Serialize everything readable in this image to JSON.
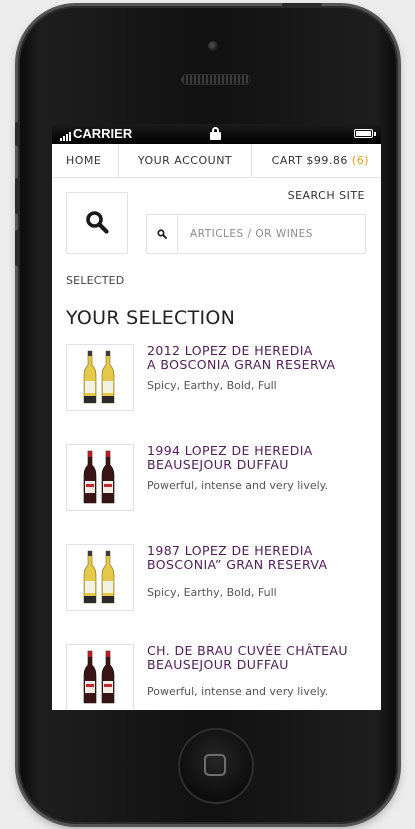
{
  "status_bar": {
    "carrier": "CARRIER"
  },
  "nav": {
    "home": "HOME",
    "account": "YOUR ACCOUNT",
    "cart_label": "CART $99.86",
    "cart_count": "(6)"
  },
  "search": {
    "title": "SEARCH SITE",
    "placeholder": "ARTICLES / OR WINES"
  },
  "selected_label": "SELECTED",
  "section_title": "YOUR SELECTION",
  "products": [
    {
      "name_line1": "2012 LOPEZ DE HEREDIA",
      "name_line2": "A BOSCONIA GRAN RESERVA",
      "description": "Spicy, Earthy, Bold, Full",
      "wine": "white"
    },
    {
      "name_line1": "1994 LOPEZ DE HEREDIA",
      "name_line2": "BEAUSEJOUR DUFFAU",
      "description": "Powerful, intense and very lively.",
      "wine": "red"
    },
    {
      "name_line1": "1987 LOPEZ DE HEREDIA",
      "name_line2": "BOSCONIA” GRAN RESERVA",
      "description": "Spicy, Earthy, Bold, Full",
      "wine": "white"
    },
    {
      "name_line1": "CH. DE BRAU CUVÉE CHÂTEAU",
      "name_line2": "BEAUSEJOUR DUFFAU",
      "description": "Powerful, intense and very lively.",
      "wine": "red"
    }
  ],
  "colors": {
    "product_title": "#4f1e56",
    "cart_count": "#e6a21c",
    "white_wine_bottle": "#e3c84a",
    "red_wine_bottle": "#3a1518"
  }
}
